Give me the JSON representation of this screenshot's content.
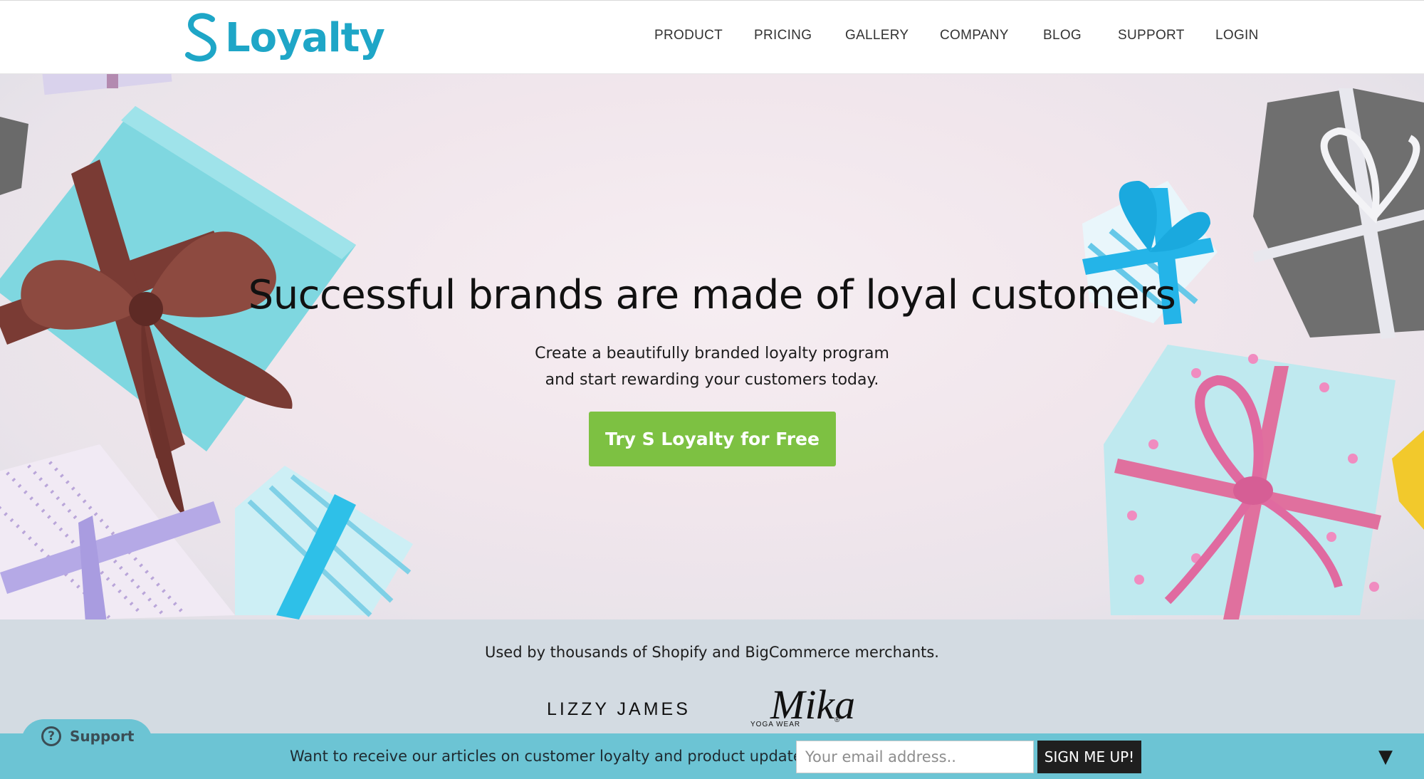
{
  "header": {
    "logo_text": "Loyalty",
    "logo_mark": "S",
    "brand_color": "#1ea6c7",
    "nav": [
      {
        "label": "PRODUCT"
      },
      {
        "label": "PRICING"
      },
      {
        "label": "GALLERY"
      },
      {
        "label": "COMPANY"
      },
      {
        "label": "BLOG"
      },
      {
        "label": "SUPPORT"
      },
      {
        "label": "LOGIN"
      }
    ]
  },
  "hero": {
    "title": "Successful brands are made of loyal customers",
    "subtitle_line1": "Create a beautifully branded loyalty program",
    "subtitle_line2": "and start rewarding your customers today.",
    "cta_label": "Try S Loyalty for Free",
    "cta_color": "#7dc142",
    "background_image": "gift-boxes-photo"
  },
  "merchants": {
    "text": "Used by thousands of Shopify and BigCommerce merchants.",
    "brands": [
      {
        "name": "LIZZY JAMES"
      },
      {
        "name": "Mika",
        "tagline": "YOGA WEAR",
        "mark": "®"
      }
    ]
  },
  "support_widget": {
    "label": "Support",
    "icon": "question-circle-icon"
  },
  "newsletter": {
    "text": "Want to receive our articles on customer loyalty and product updates?",
    "email_placeholder": "Your email address..",
    "email_value": "",
    "button_label": "SIGN ME UP!",
    "toggle_icon": "▼",
    "bar_color": "#6cc4d4"
  }
}
